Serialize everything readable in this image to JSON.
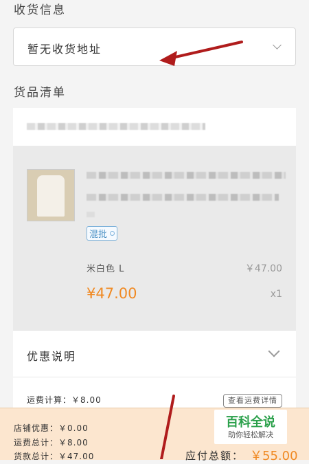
{
  "shipping": {
    "title": "收货信息",
    "address_placeholder": "暂无收货地址"
  },
  "goods": {
    "title": "货品清单",
    "item": {
      "badge": "混批",
      "spec": "米白色 L",
      "original_price": "￥47.00",
      "price": "¥47.00",
      "quantity": "x1"
    },
    "promo_label": "优惠说明",
    "shipping_calc": "运费计算：￥8.00",
    "shipping_detail_button": "查看运费详情"
  },
  "summary": {
    "store_discount": "店铺优惠：￥0.00",
    "shipping_total": "运费总计：￥8.00",
    "goods_total": "货款总计：￥47.00",
    "payable_label": "应付总额：",
    "payable_value": "￥55.00"
  },
  "watermark": {
    "main": "百科全说",
    "sub": "助你轻松解决"
  },
  "colors": {
    "accent": "#f08a24",
    "badge": "#4a90c4",
    "arrow": "#b01c1c",
    "footer_bg": "#fce6cf"
  }
}
